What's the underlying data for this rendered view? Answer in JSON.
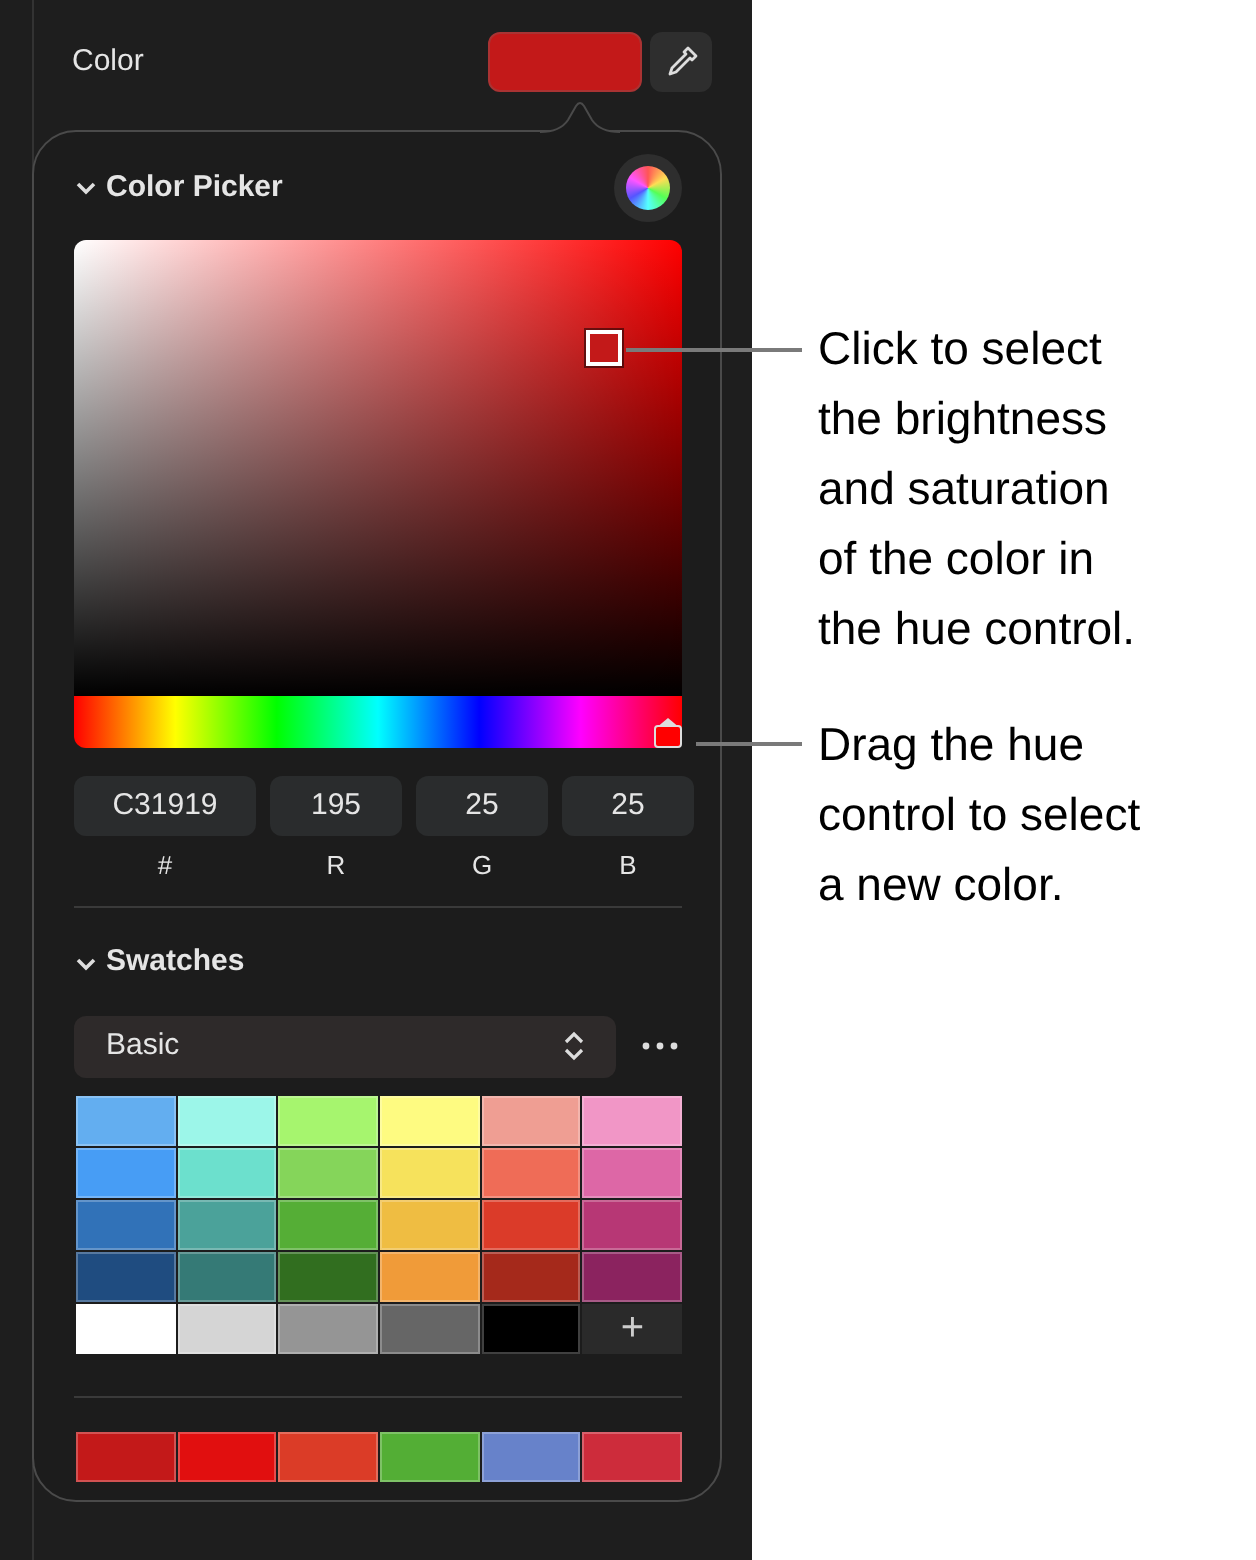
{
  "color_row": {
    "label": "Color",
    "color": "#c31919"
  },
  "color_picker": {
    "title": "Color Picker",
    "expanded": true,
    "hue_slider": {
      "level": 1.0
    },
    "fields": [
      {
        "label": "#",
        "value": "C31919"
      },
      {
        "label": "R",
        "value": "195"
      },
      {
        "label": "G",
        "value": "25"
      },
      {
        "label": "B",
        "value": "25"
      }
    ]
  },
  "swatches": {
    "title": "Swatches",
    "expanded": true,
    "palette": "Basic",
    "grid": [
      {
        "color": "#63aef0"
      },
      {
        "color": "#9cf6e9"
      },
      {
        "color": "#a6f56e"
      },
      {
        "color": "#fefb81"
      },
      {
        "color": "#ef9e93"
      },
      {
        "color": "#f196c6"
      },
      {
        "color": "#479df5"
      },
      {
        "color": "#6ce0cd"
      },
      {
        "color": "#85d55a"
      },
      {
        "color": "#f6e25c"
      },
      {
        "color": "#ef6c57"
      },
      {
        "color": "#dd67a6"
      },
      {
        "color": "#3172b8"
      },
      {
        "color": "#4ba29a"
      },
      {
        "color": "#55ae36"
      },
      {
        "color": "#efbd42"
      },
      {
        "color": "#db3b29"
      },
      {
        "color": "#b73775"
      },
      {
        "color": "#1f4c80"
      },
      {
        "color": "#357a76"
      },
      {
        "color": "#316e1f"
      },
      {
        "color": "#f09b39"
      },
      {
        "color": "#a5291b"
      },
      {
        "color": "#8b235f"
      },
      {
        "color": "#ffffff"
      },
      {
        "color": "#d5d5d5"
      },
      {
        "color": "#959595"
      },
      {
        "color": "#666666"
      },
      {
        "color": "#000000"
      }
    ],
    "add_label": "+",
    "recent": [
      {
        "color": "#c31919"
      },
      {
        "color": "#e10f0f"
      },
      {
        "color": "#db3c27"
      },
      {
        "color": "#53ae35"
      },
      {
        "color": "#6782ca"
      },
      {
        "color": "#cd2c3b"
      }
    ]
  },
  "callouts": [
    {
      "text": "Click to select\nthe brightness\nand saturation\nof the color in\nthe hue control."
    },
    {
      "text": "Drag the hue\ncontrol to select\na new color."
    }
  ]
}
